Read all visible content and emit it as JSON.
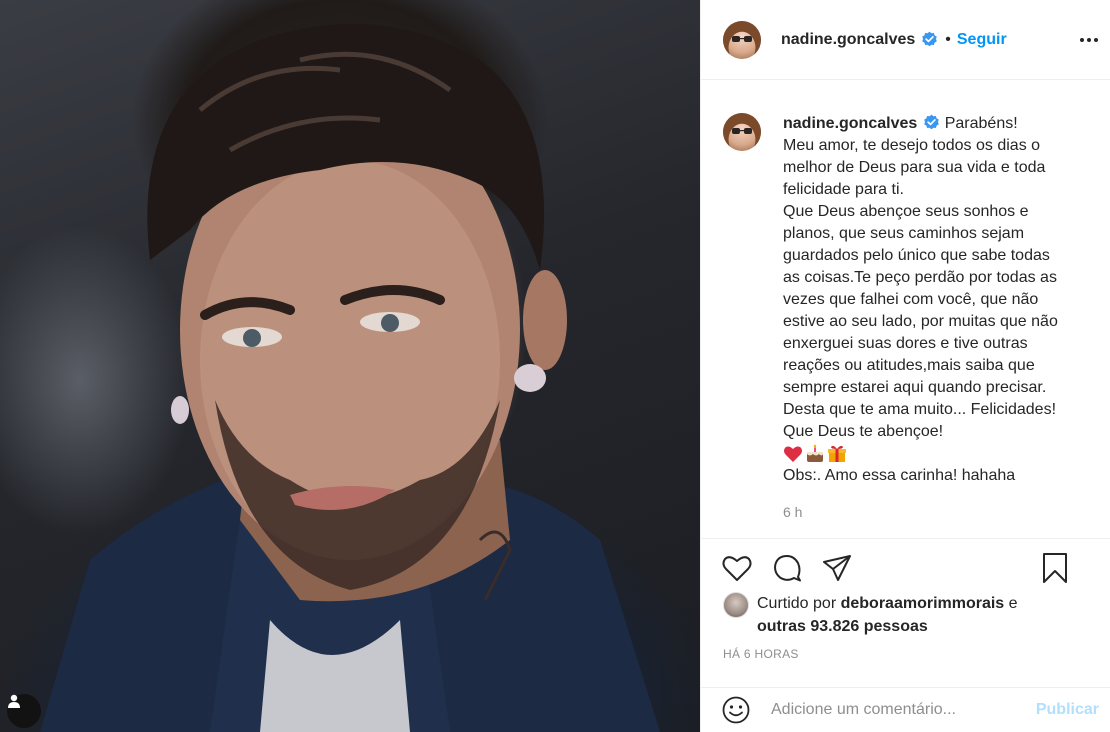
{
  "post": {
    "username": "nadine.goncalves",
    "follow_separator": "•",
    "follow_label": "Seguir",
    "caption_lines": [
      "Parabéns!",
      "Meu amor, te desejo todos os dias o",
      "melhor de Deus para sua vida e toda",
      "felicidade para ti.",
      "Que Deus abençoe seus sonhos e",
      "planos, que seus caminhos sejam",
      "guardados pelo único que sabe todas",
      "as coisas.Te peço perdão por todas as",
      "vezes que falhei com você, que não",
      "estive ao seu lado, por muitas que não",
      "enxerguei suas dores e tive outras",
      "reações ou atitudes,mais saiba que",
      "sempre estarei aqui quando precisar.",
      "Desta que te ama muito... Felicidades!",
      "Que Deus te abençoe!"
    ],
    "emojis": [
      "heart-emoji",
      "cake-emoji",
      "gift-emoji"
    ],
    "caption_last_line": "Obs:. Amo essa carinha! hahaha",
    "caption_time": "6 h",
    "likes": {
      "prefix": "Curtido por ",
      "liker": "deboraamorimmorais",
      "connector": " e",
      "others": "outras 93.826 pessoas"
    },
    "age": "HÁ 6 HORAS",
    "comment_placeholder": "Adicione um comentário...",
    "publish_label": "Publicar"
  },
  "colors": {
    "link_blue": "#0095f6",
    "publish_disabled": "#b2dffc",
    "muted": "#8e8e8e",
    "verified_blue": "#3897f0"
  },
  "icons": [
    "verified-badge-icon",
    "more-options-icon",
    "like-heart-icon",
    "comment-icon",
    "share-icon",
    "save-bookmark-icon",
    "emoji-smile-icon",
    "user-icon"
  ]
}
